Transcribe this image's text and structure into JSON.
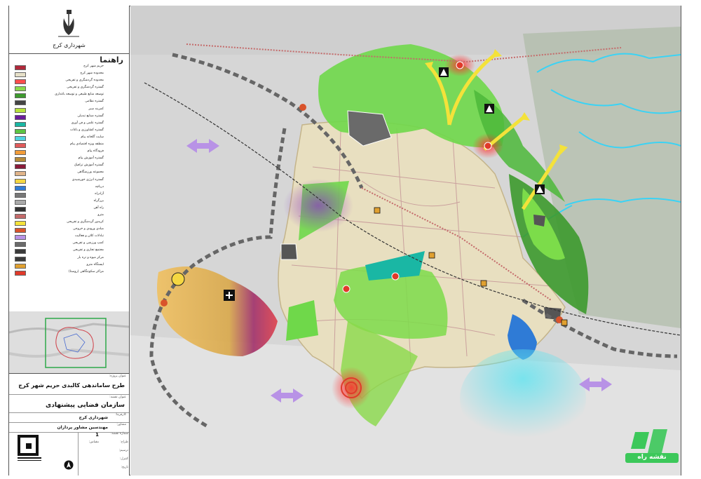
{
  "header": {
    "city_hall": "شهرداری کرج"
  },
  "legend": {
    "heading": "راهنما",
    "items": [
      {
        "label": "حریم شهر کرج",
        "color": "#b0283a"
      },
      {
        "label": "محدوده شهر کرج",
        "color": "#e6e0c8"
      },
      {
        "label": "محدوده گردشگری و تفریحی",
        "color": "#ff4d4d"
      },
      {
        "label": "گستره گردشگری و تفریحی",
        "color": "#8ad94a"
      },
      {
        "label": "توسعه منابع طبیعی و توسعه باغداری",
        "color": "#3d9a2e"
      },
      {
        "label": "گستره نظامی",
        "color": "#444444"
      },
      {
        "label": "کمربند سبز",
        "color": "#b6e23a"
      },
      {
        "label": "گستره صنایع تبدیلی",
        "color": "#6a1b9a"
      },
      {
        "label": "گستره علمی و فن آوری",
        "color": "#1ab7a4"
      },
      {
        "label": "گستره کشاورزی و باغات",
        "color": "#5cc443"
      },
      {
        "label": "سایت گلخانه پیام",
        "color": "#4fd3e0"
      },
      {
        "label": "منطقه ویژه اقتصادی پیام",
        "color": "#e05a5a"
      },
      {
        "label": "فرودگاه پیام",
        "color": "#f29c38"
      },
      {
        "label": "گستره آموزش پیام",
        "color": "#b58a3a"
      },
      {
        "label": "گستره آموزش ترافیک",
        "color": "#8a1a3a"
      },
      {
        "label": "مجموعه ورزشگاهی",
        "color": "#e0b48a"
      },
      {
        "label": "گستره انرژی خورشیدی",
        "color": "#f5d742"
      },
      {
        "label": "دریاچه",
        "color": "#2f7bd6"
      },
      {
        "label": "آزادراه",
        "color": "#777777"
      },
      {
        "label": "بزرگراه",
        "color": "#aaaaaa"
      },
      {
        "label": "راه آهن",
        "color": "#333333"
      },
      {
        "label": "مترو",
        "color": "#c46a6a"
      },
      {
        "label": "کریدور گردشگری و تفریحی",
        "color": "#f4e23a"
      },
      {
        "label": "مبادی ورودی و خروجی",
        "color": "#d9532b"
      },
      {
        "label": "تبادلات کلان و فعالیت",
        "color": "#b892e6"
      },
      {
        "label": "کمپ ورزشی و تفریحی",
        "color": "#6a6a6a"
      },
      {
        "label": "مجتمع تجاری و تفریحی",
        "color": "#3a3a3a"
      },
      {
        "label": "مرکز میوه و تره بار",
        "color": "#3a3a3a"
      },
      {
        "label": "ایستگاه مترو",
        "color": "#e0a030"
      },
      {
        "label": "مراکز سکونتگاهی (روستا)",
        "color": "#e03a2a"
      }
    ]
  },
  "title_block": {
    "project_label": "عنوان پروژه:",
    "project": "طرح ساماندهی کالبدی حریم شهر کرج",
    "map_label": "عنوان نقشه:",
    "map_title": "سازمان فضایی پیشنهادی",
    "employer_label": "کارفرما:",
    "employer": "شهرداری کرج",
    "consultant_label": "مشاور:",
    "consultant": "مهندسین مشاور پردازان",
    "sheet_label": "شماره نقشه:",
    "sheet_number": "1",
    "designer_label": "طراح:",
    "drafter_label": "ترسیم:",
    "scale_label": "مقیاس:",
    "checker_label": "کنترل:",
    "date_label": "تاریخ:"
  },
  "watermark": {
    "text": "نقشه راه"
  }
}
